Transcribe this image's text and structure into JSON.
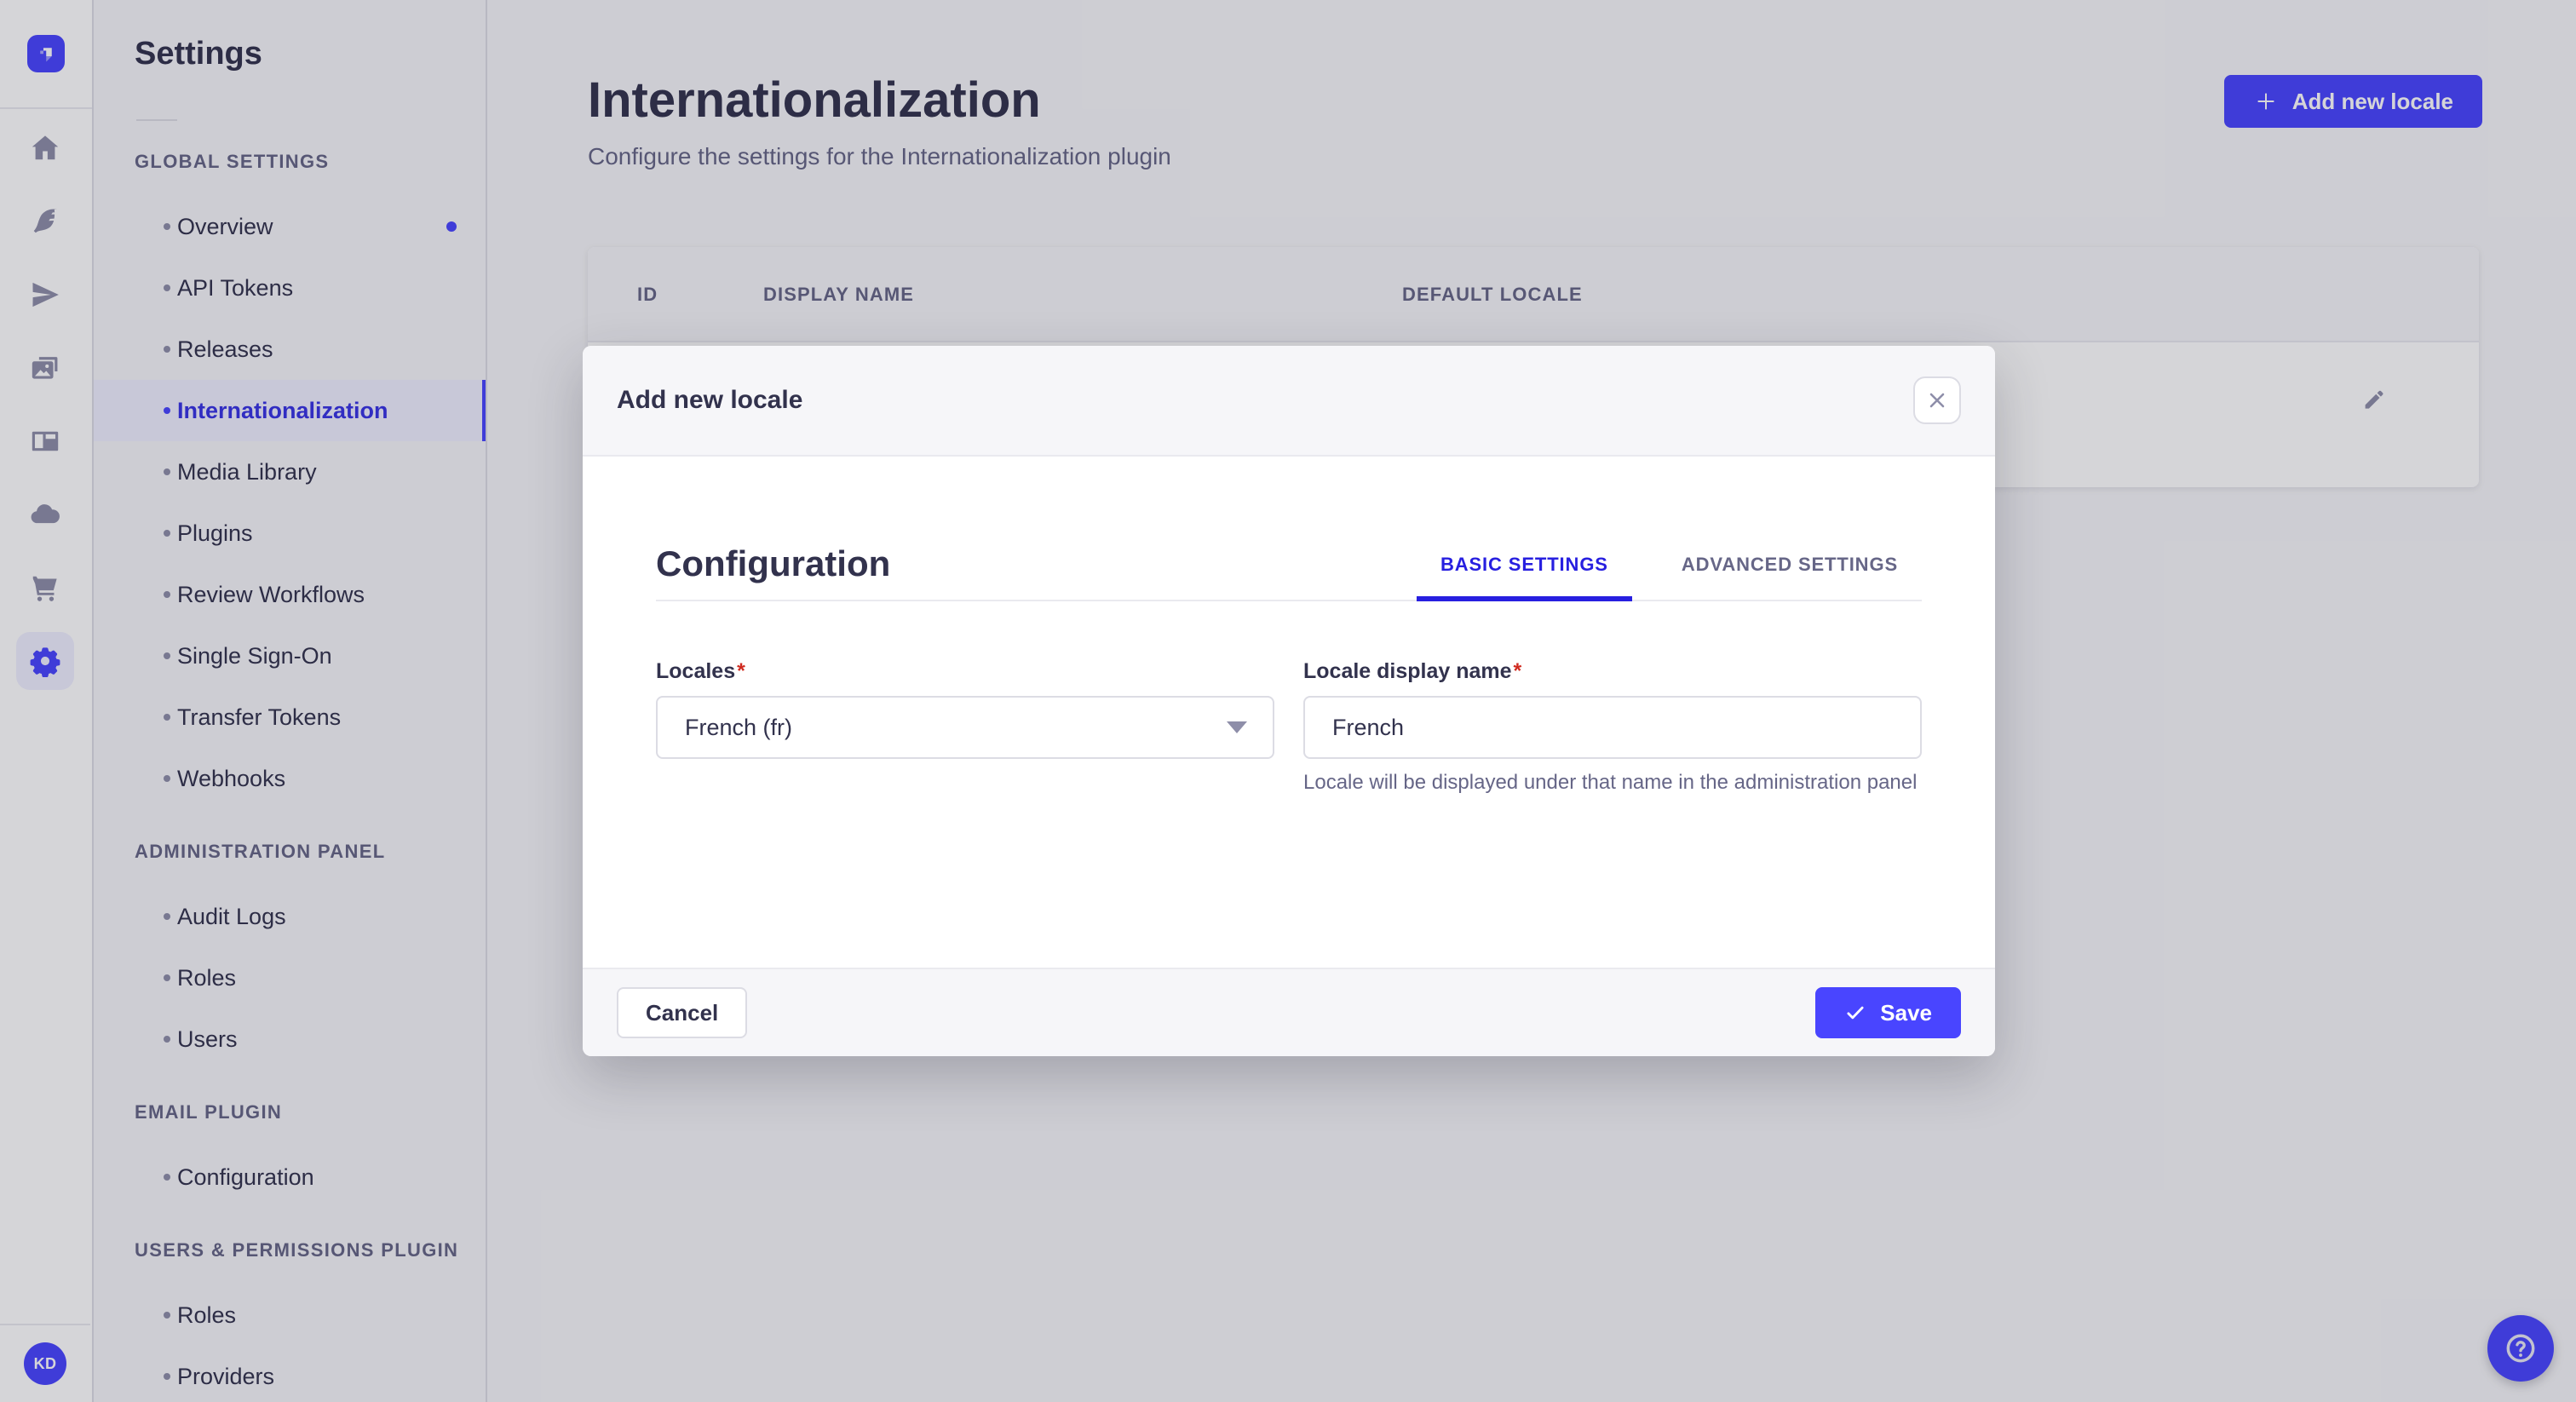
{
  "brand": {
    "accent": "#4945ff",
    "active_link": "#271fe0",
    "danger": "#d02b20"
  },
  "rail": {
    "logo_icon": "strapi-logo-icon",
    "icons": [
      {
        "name": "home-icon",
        "active": false
      },
      {
        "name": "feather-icon",
        "active": false
      },
      {
        "name": "send-icon",
        "active": false
      },
      {
        "name": "media-icon",
        "active": false
      },
      {
        "name": "layout-icon",
        "active": false
      },
      {
        "name": "cloud-icon",
        "active": false
      },
      {
        "name": "cart-icon",
        "active": false
      },
      {
        "name": "gear-icon",
        "active": true
      }
    ],
    "avatar_initials": "KD"
  },
  "sidebar": {
    "title": "Settings",
    "sections": [
      {
        "label": "GLOBAL SETTINGS",
        "items": [
          {
            "label": "Overview",
            "notification": true
          },
          {
            "label": "API Tokens"
          },
          {
            "label": "Releases"
          },
          {
            "label": "Internationalization",
            "active": true
          },
          {
            "label": "Media Library"
          },
          {
            "label": "Plugins"
          },
          {
            "label": "Review Workflows"
          },
          {
            "label": "Single Sign-On"
          },
          {
            "label": "Transfer Tokens"
          },
          {
            "label": "Webhooks"
          }
        ]
      },
      {
        "label": "ADMINISTRATION PANEL",
        "items": [
          {
            "label": "Audit Logs"
          },
          {
            "label": "Roles"
          },
          {
            "label": "Users"
          }
        ]
      },
      {
        "label": "EMAIL PLUGIN",
        "items": [
          {
            "label": "Configuration"
          }
        ]
      },
      {
        "label": "USERS & PERMISSIONS PLUGIN",
        "items": [
          {
            "label": "Roles"
          },
          {
            "label": "Providers"
          }
        ]
      }
    ]
  },
  "main": {
    "title": "Internationalization",
    "subtitle": "Configure the settings for the Internationalization plugin",
    "add_button_label": "Add new locale",
    "table": {
      "columns": [
        "ID",
        "DISPLAY NAME",
        "DEFAULT LOCALE"
      ],
      "row_action_icon": "pencil-icon"
    }
  },
  "modal": {
    "title": "Add new locale",
    "section_title": "Configuration",
    "tabs": [
      {
        "label": "BASIC SETTINGS",
        "active": true
      },
      {
        "label": "ADVANCED SETTINGS",
        "active": false
      }
    ],
    "required_mark": "*",
    "fields": {
      "locales": {
        "label": "Locales",
        "required": true,
        "value": "French (fr)"
      },
      "display_name": {
        "label": "Locale display name",
        "required": true,
        "value": "French",
        "help": "Locale will be displayed under that name in the administration panel"
      }
    },
    "footer": {
      "cancel_label": "Cancel",
      "save_label": "Save"
    }
  },
  "fab": {
    "icon": "question-circle-icon"
  }
}
